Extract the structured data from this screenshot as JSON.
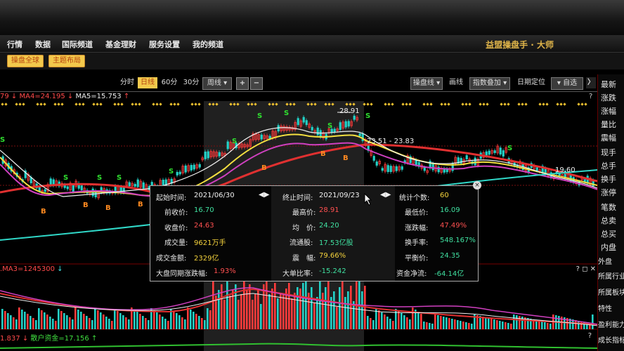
{
  "menu": [
    "行情",
    "数据",
    "国际频道",
    "基金理财",
    "服务设置",
    "我的频道"
  ],
  "app_title": "益盟操盘手 · 大师",
  "subbar": {
    "btn1": "操盘全球",
    "btn2": "主题布局"
  },
  "toolbar": {
    "periods": [
      "分时",
      "日线",
      "60分",
      "30分",
      "周线"
    ],
    "active_period": "日线",
    "plus": "+",
    "minus": "−",
    "caopanxian": "操盘线",
    "huaxian": "画线",
    "zhibiao": "指数叠加",
    "riqidingwei": "日期定位",
    "zixuan": "自选",
    "arrow": "〉"
  },
  "indicator_line": {
    "ma3_prefix": "79",
    "ma4": "MA4=24.195",
    "ma5": "MA5=15.753"
  },
  "chart_labels": {
    "peak": "28.91",
    "range": "23.51 - 23.83",
    "right": "19.60"
  },
  "signals": {
    "s": "S",
    "b": "B"
  },
  "popup": {
    "start_label": "起始时间:",
    "start_value": "2021/06/30",
    "end_label": "终止时间:",
    "end_value": "2021/09/23",
    "count_label": "统计个数:",
    "count_value": "60",
    "prev_close_label": "前收价:",
    "prev_close_value": "16.70",
    "high_label": "最高价:",
    "high_value": "28.91",
    "low_label": "最低价:",
    "low_value": "16.09",
    "close_label": "收盘价:",
    "close_value": "24.63",
    "avg_label": "均　价:",
    "avg_value": "24.20",
    "change_label": "涨跌幅:",
    "change_value": "47.49%",
    "volume_label": "成交量:",
    "volume_value": "9621万手",
    "float_label": "流通股:",
    "float_value": "17.53亿股",
    "turnover_label": "换手率:",
    "turnover_value": "548.167%",
    "amount_label": "成交金额:",
    "amount_value": "2329亿",
    "amplitude_label": "震　幅:",
    "amplitude_value": "79.66%",
    "balance_label": "平衡价:",
    "balance_value": "24.35",
    "index_change_label": "大盘同期涨跌幅:",
    "index_change_value": "1.93%",
    "big_order_label": "大单比率:",
    "big_order_value": "-15.242",
    "net_flow_label": "资金净流:",
    "net_flow_value": "-64.14亿",
    "close_x": "×"
  },
  "volume_indicator": {
    "text": ".MA3=1245300"
  },
  "volume_controls": "? ◻ ✕",
  "bottom_indicator": {
    "prefix": "1.837",
    "text": "散户资金=17.156"
  },
  "right_sidebar": [
    "最新",
    "涨跌",
    "涨幅",
    "量比",
    "震幅",
    "现手",
    "总手",
    "换手",
    "涨停",
    "笔数",
    "总卖",
    "总买",
    "内盘",
    "外盘",
    "所属行业",
    "所属板块",
    "特性",
    "盈利能力",
    "成长指标"
  ],
  "colors": {
    "accent": "#f3c94c",
    "up": "#ff3b3b",
    "down": "#23d2c8",
    "ma_yellow": "#f4e040",
    "ma_pink": "#e040c0",
    "ma_white": "#f0f0f0"
  }
}
